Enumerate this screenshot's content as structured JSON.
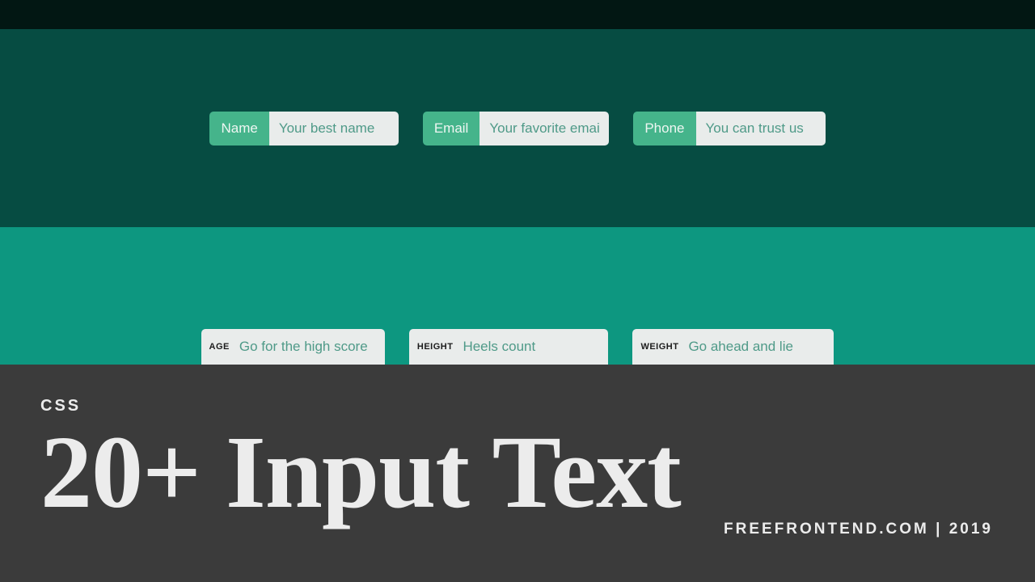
{
  "row1": {
    "fields": [
      {
        "label": "Name",
        "placeholder": "Your best name"
      },
      {
        "label": "Email",
        "placeholder": "Your favorite email"
      },
      {
        "label": "Phone",
        "placeholder": "You can trust us"
      }
    ]
  },
  "row2": {
    "fields": [
      {
        "label": "AGE",
        "placeholder": "Go for the high score"
      },
      {
        "label": "HEIGHT",
        "placeholder": "Heels count"
      },
      {
        "label": "WEIGHT",
        "placeholder": "Go ahead and lie"
      }
    ]
  },
  "footer": {
    "kicker": "CSS",
    "title": "20+ Input Text",
    "brand": "FREEFRONTEND.COM | 2019"
  }
}
